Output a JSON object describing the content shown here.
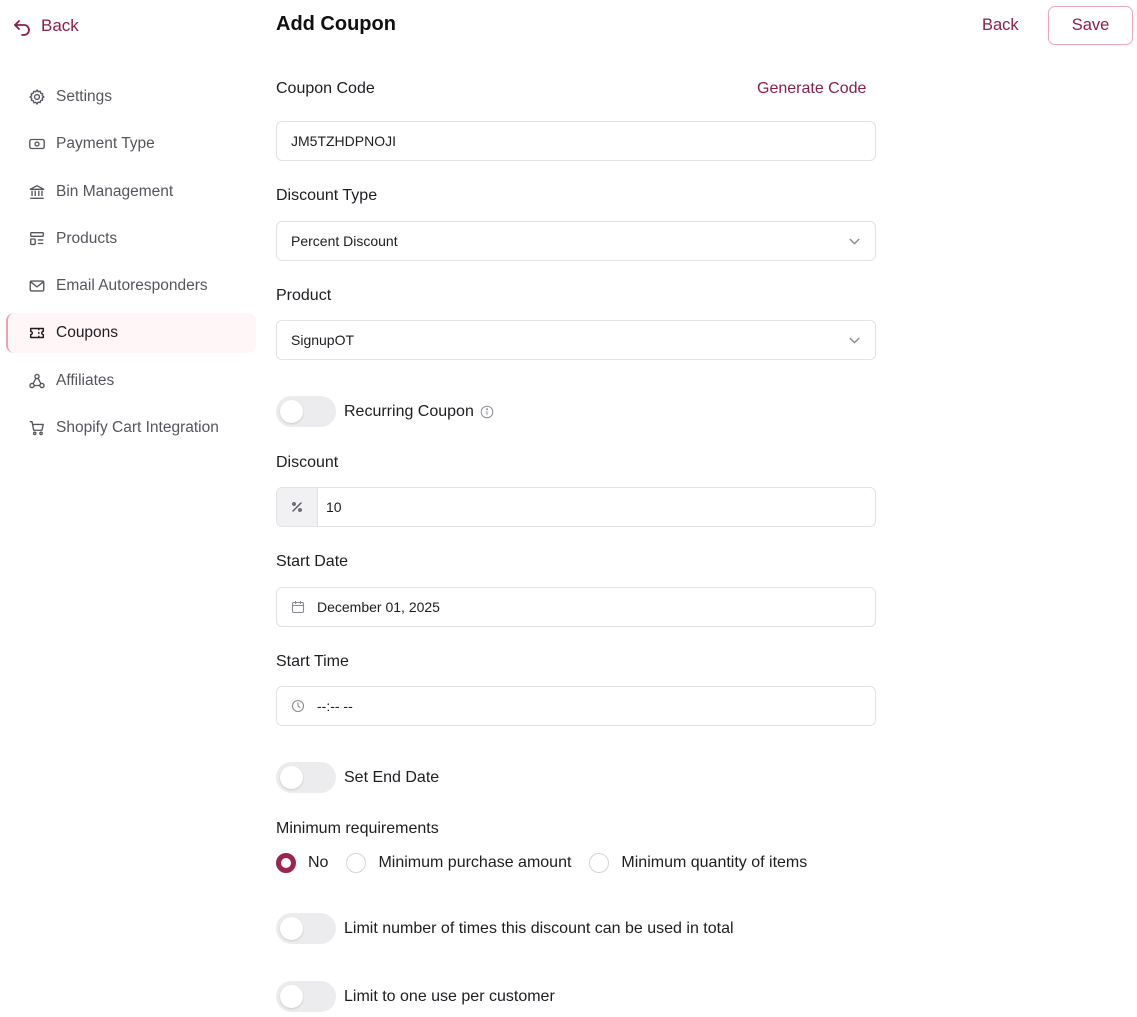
{
  "sidebar": {
    "back_label": "Back",
    "items": [
      {
        "label": "Settings",
        "icon": "gear-icon"
      },
      {
        "label": "Payment Type",
        "icon": "banknote-icon"
      },
      {
        "label": "Bin Management",
        "icon": "bank-icon"
      },
      {
        "label": "Products",
        "icon": "product-list-icon"
      },
      {
        "label": "Email Autoresponders",
        "icon": "mail-icon"
      },
      {
        "label": "Coupons",
        "icon": "ticket-icon",
        "active": true
      },
      {
        "label": "Affiliates",
        "icon": "network-icon"
      },
      {
        "label": "Shopify Cart Integration",
        "icon": "cart-icon"
      }
    ]
  },
  "header": {
    "title": "Add Coupon",
    "back_label": "Back",
    "save_label": "Save"
  },
  "form": {
    "coupon_code": {
      "label": "Coupon Code",
      "value": "JM5TZHDPNOJI",
      "generate_label": "Generate Code"
    },
    "discount_type": {
      "label": "Discount Type",
      "value": "Percent Discount"
    },
    "product": {
      "label": "Product",
      "value": "SignupOT"
    },
    "recurring": {
      "label": "Recurring Coupon",
      "enabled": false
    },
    "discount": {
      "label": "Discount",
      "value": "10"
    },
    "start_date": {
      "label": "Start Date",
      "value": "December 01, 2025"
    },
    "start_time": {
      "label": "Start Time",
      "value": "--:-- --"
    },
    "end_date": {
      "label": "Set End Date",
      "enabled": false
    },
    "min_req": {
      "label": "Minimum requirements",
      "options": [
        "No",
        "Minimum purchase amount",
        "Minimum quantity of items"
      ],
      "selected": "No"
    },
    "limit_total": {
      "label": "Limit number of times this discount can be used in total",
      "enabled": false
    },
    "limit_customer": {
      "label": "Limit to one use per customer",
      "enabled": false
    }
  },
  "colors": {
    "accent": "#8a1f4a",
    "radio_checked": "#9b2450",
    "active_bg": "#fff6f8",
    "active_border": "#e9a0b8"
  }
}
